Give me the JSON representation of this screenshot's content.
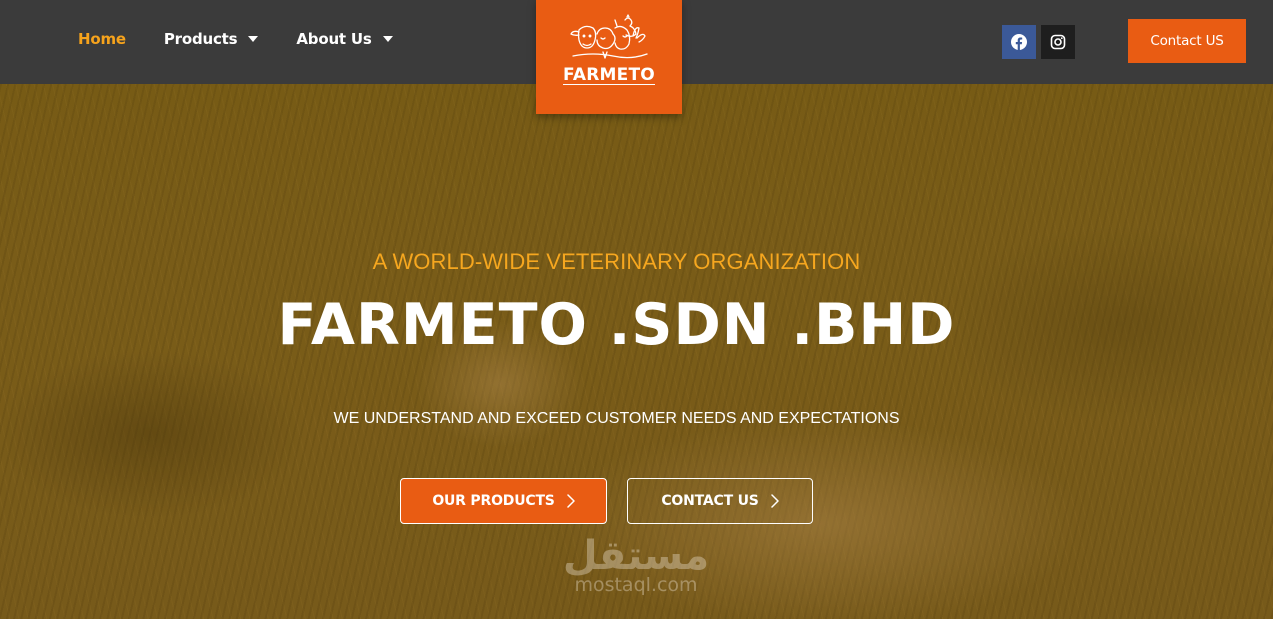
{
  "nav": {
    "items": [
      {
        "label": "Home",
        "active": true,
        "dropdown": false
      },
      {
        "label": "Products",
        "active": false,
        "dropdown": true
      },
      {
        "label": "About Us",
        "active": false,
        "dropdown": true
      }
    ]
  },
  "logo": {
    "text": "FARMETO",
    "icon": "farm-animals-logo"
  },
  "social": [
    {
      "icon": "facebook-icon",
      "color": "#3b5998"
    },
    {
      "icon": "instagram-icon",
      "color": "#1e1e1e"
    }
  ],
  "header_cta": {
    "label": "Contact US"
  },
  "hero": {
    "tagline": "A WORLD-WIDE VETERINARY ORGANIZATION",
    "title": "FARMETO .SDN .BHD",
    "subtitle": "WE UNDERSTAND AND EXCEED CUSTOMER NEEDS AND EXPECTATIONS",
    "primary_button": "OUR PRODUCTS",
    "secondary_button": "CONTACT US"
  },
  "watermark": {
    "arabic": "مستقل",
    "latin": "mostaql.com"
  },
  "colors": {
    "accent": "#e95c13",
    "tagline": "#f6a71f",
    "active_nav": "#f6a31c",
    "header_bg": "#3b3b3b",
    "hero_tint": "#7b611c"
  }
}
